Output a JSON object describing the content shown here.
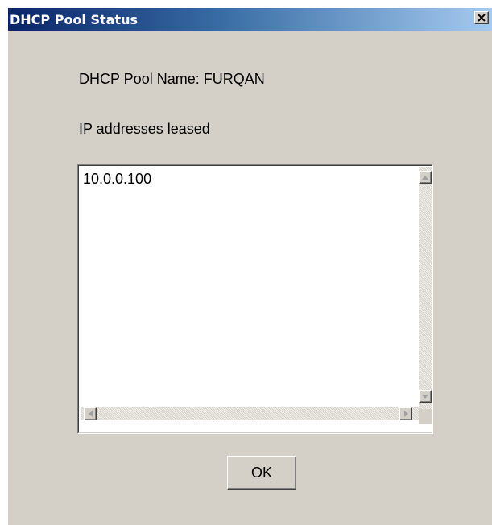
{
  "window": {
    "title": "DHCP Pool Status",
    "close_icon": "close-icon"
  },
  "pool": {
    "name_label": "DHCP Pool Name: FURQAN",
    "leased_label": "IP addresses leased",
    "leased_addresses": [
      "10.0.0.100"
    ]
  },
  "buttons": {
    "ok_label": "OK"
  },
  "icons": {
    "scroll_up": "arrow-up-icon",
    "scroll_down": "arrow-down-icon",
    "scroll_left": "arrow-left-icon",
    "scroll_right": "arrow-right-icon"
  },
  "colors": {
    "titlebar_start": "#0a246a",
    "titlebar_end": "#a6caf0",
    "window_face": "#d4d0c8"
  }
}
